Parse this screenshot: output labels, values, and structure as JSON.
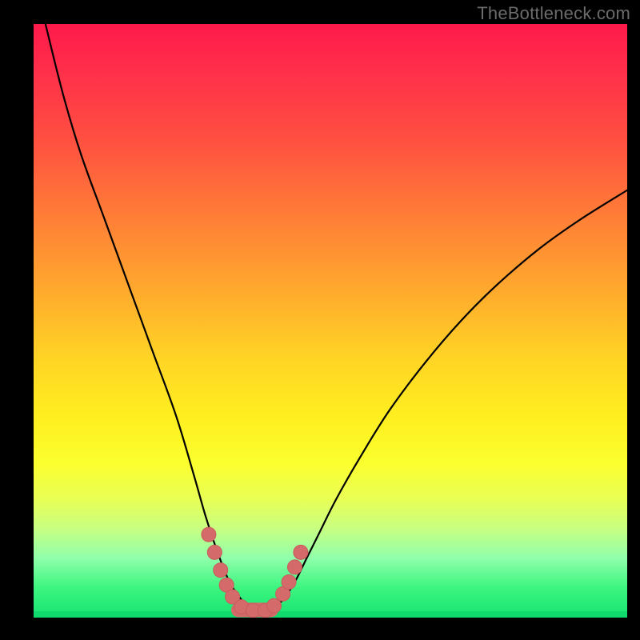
{
  "watermark": "TheBottleneck.com",
  "colors": {
    "frame": "#000000",
    "curve": "#000000",
    "marker_fill": "#d46a6a",
    "marker_stroke": "#c95b5b",
    "gradient_top": "#ff1a4b",
    "gradient_bottom": "#16e272"
  },
  "chart_data": {
    "type": "line",
    "title": "",
    "xlabel": "",
    "ylabel": "",
    "xlim": [
      0,
      100
    ],
    "ylim": [
      0,
      100
    ],
    "grid": false,
    "legend": false,
    "series": [
      {
        "name": "bottleneck-curve",
        "x": [
          2,
          5,
          8,
          12,
          16,
          20,
          24,
          27,
          29,
          31,
          33,
          35,
          36,
          37,
          38,
          39,
          40,
          42,
          44,
          46,
          48,
          51,
          55,
          60,
          66,
          72,
          78,
          85,
          92,
          100
        ],
        "values": [
          100,
          88,
          78,
          67,
          56,
          45,
          34,
          24,
          17,
          11,
          6,
          3,
          1.5,
          1,
          1,
          1,
          1.5,
          3,
          6,
          10,
          14,
          20,
          27,
          35,
          43,
          50,
          56,
          62,
          67,
          72
        ]
      }
    ],
    "markers": [
      {
        "x": 29.5,
        "y": 14
      },
      {
        "x": 30.5,
        "y": 11
      },
      {
        "x": 31.5,
        "y": 8
      },
      {
        "x": 32.5,
        "y": 5.5
      },
      {
        "x": 33.5,
        "y": 3.5
      },
      {
        "x": 35.0,
        "y": 1.8
      },
      {
        "x": 37.0,
        "y": 1.2
      },
      {
        "x": 39.0,
        "y": 1.2
      },
      {
        "x": 40.5,
        "y": 2.0
      },
      {
        "x": 42.0,
        "y": 4.0
      },
      {
        "x": 43.0,
        "y": 6.0
      },
      {
        "x": 44.0,
        "y": 8.5
      },
      {
        "x": 45.0,
        "y": 11.0
      }
    ],
    "marker_thick_segment": {
      "from_x": 34.5,
      "to_x": 40.0,
      "y": 1.3
    }
  }
}
